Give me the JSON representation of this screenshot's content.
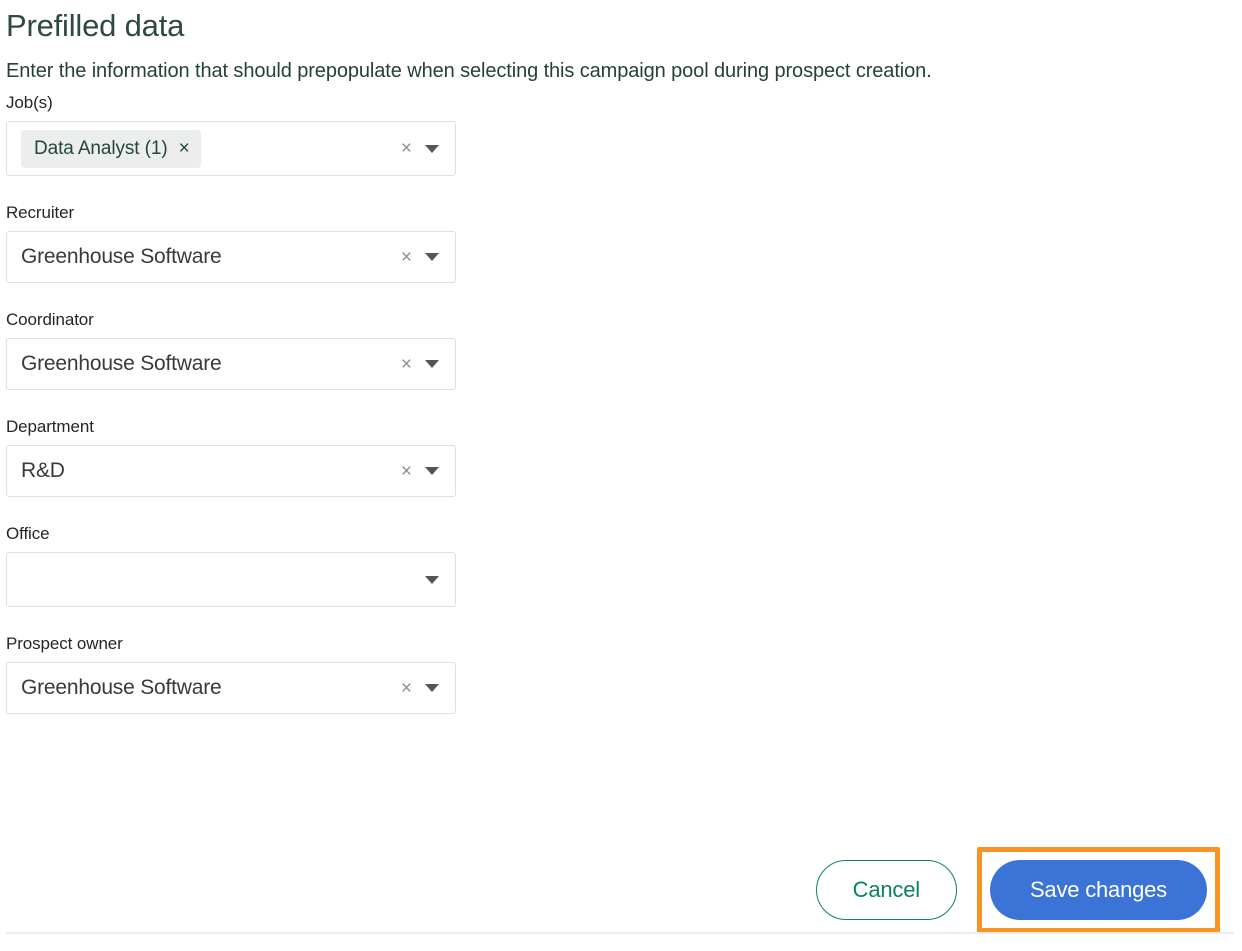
{
  "header": {
    "title": "Prefilled data",
    "subtitle": "Enter the information that should prepopulate when selecting this campaign pool during prospect creation."
  },
  "form": {
    "fields": [
      {
        "name": "jobs",
        "label": "Job(s)",
        "type": "multiselect",
        "chips": [
          {
            "label": "Data Analyst (1)",
            "remove_icon": "×"
          }
        ],
        "value": "",
        "has_clear": true,
        "clear_icon": "×",
        "caret_icon": "caret-down"
      },
      {
        "name": "recruiter",
        "label": "Recruiter",
        "type": "select",
        "value": "Greenhouse Software",
        "has_clear": true,
        "clear_icon": "×",
        "caret_icon": "caret-down"
      },
      {
        "name": "coordinator",
        "label": "Coordinator",
        "type": "select",
        "value": "Greenhouse Software",
        "has_clear": true,
        "clear_icon": "×",
        "caret_icon": "caret-down"
      },
      {
        "name": "department",
        "label": "Department",
        "type": "select",
        "value": "R&D",
        "has_clear": true,
        "clear_icon": "×",
        "caret_icon": "caret-down"
      },
      {
        "name": "office",
        "label": "Office",
        "type": "select",
        "value": "",
        "has_clear": false,
        "clear_icon": "",
        "caret_icon": "caret-down"
      },
      {
        "name": "prospect-owner",
        "label": "Prospect owner",
        "type": "select",
        "value": "Greenhouse Software",
        "has_clear": true,
        "clear_icon": "×",
        "caret_icon": "caret-down"
      }
    ]
  },
  "footer": {
    "cancel_label": "Cancel",
    "save_label": "Save changes"
  },
  "colors": {
    "title_green": "#2e4a3e",
    "chip_text_green": "#23473a",
    "chip_bg": "#eceeed",
    "cancel_green": "#0a8457",
    "save_blue": "#3b74d6",
    "highlight_orange": "#f99424",
    "field_border": "#e0e0e0"
  }
}
